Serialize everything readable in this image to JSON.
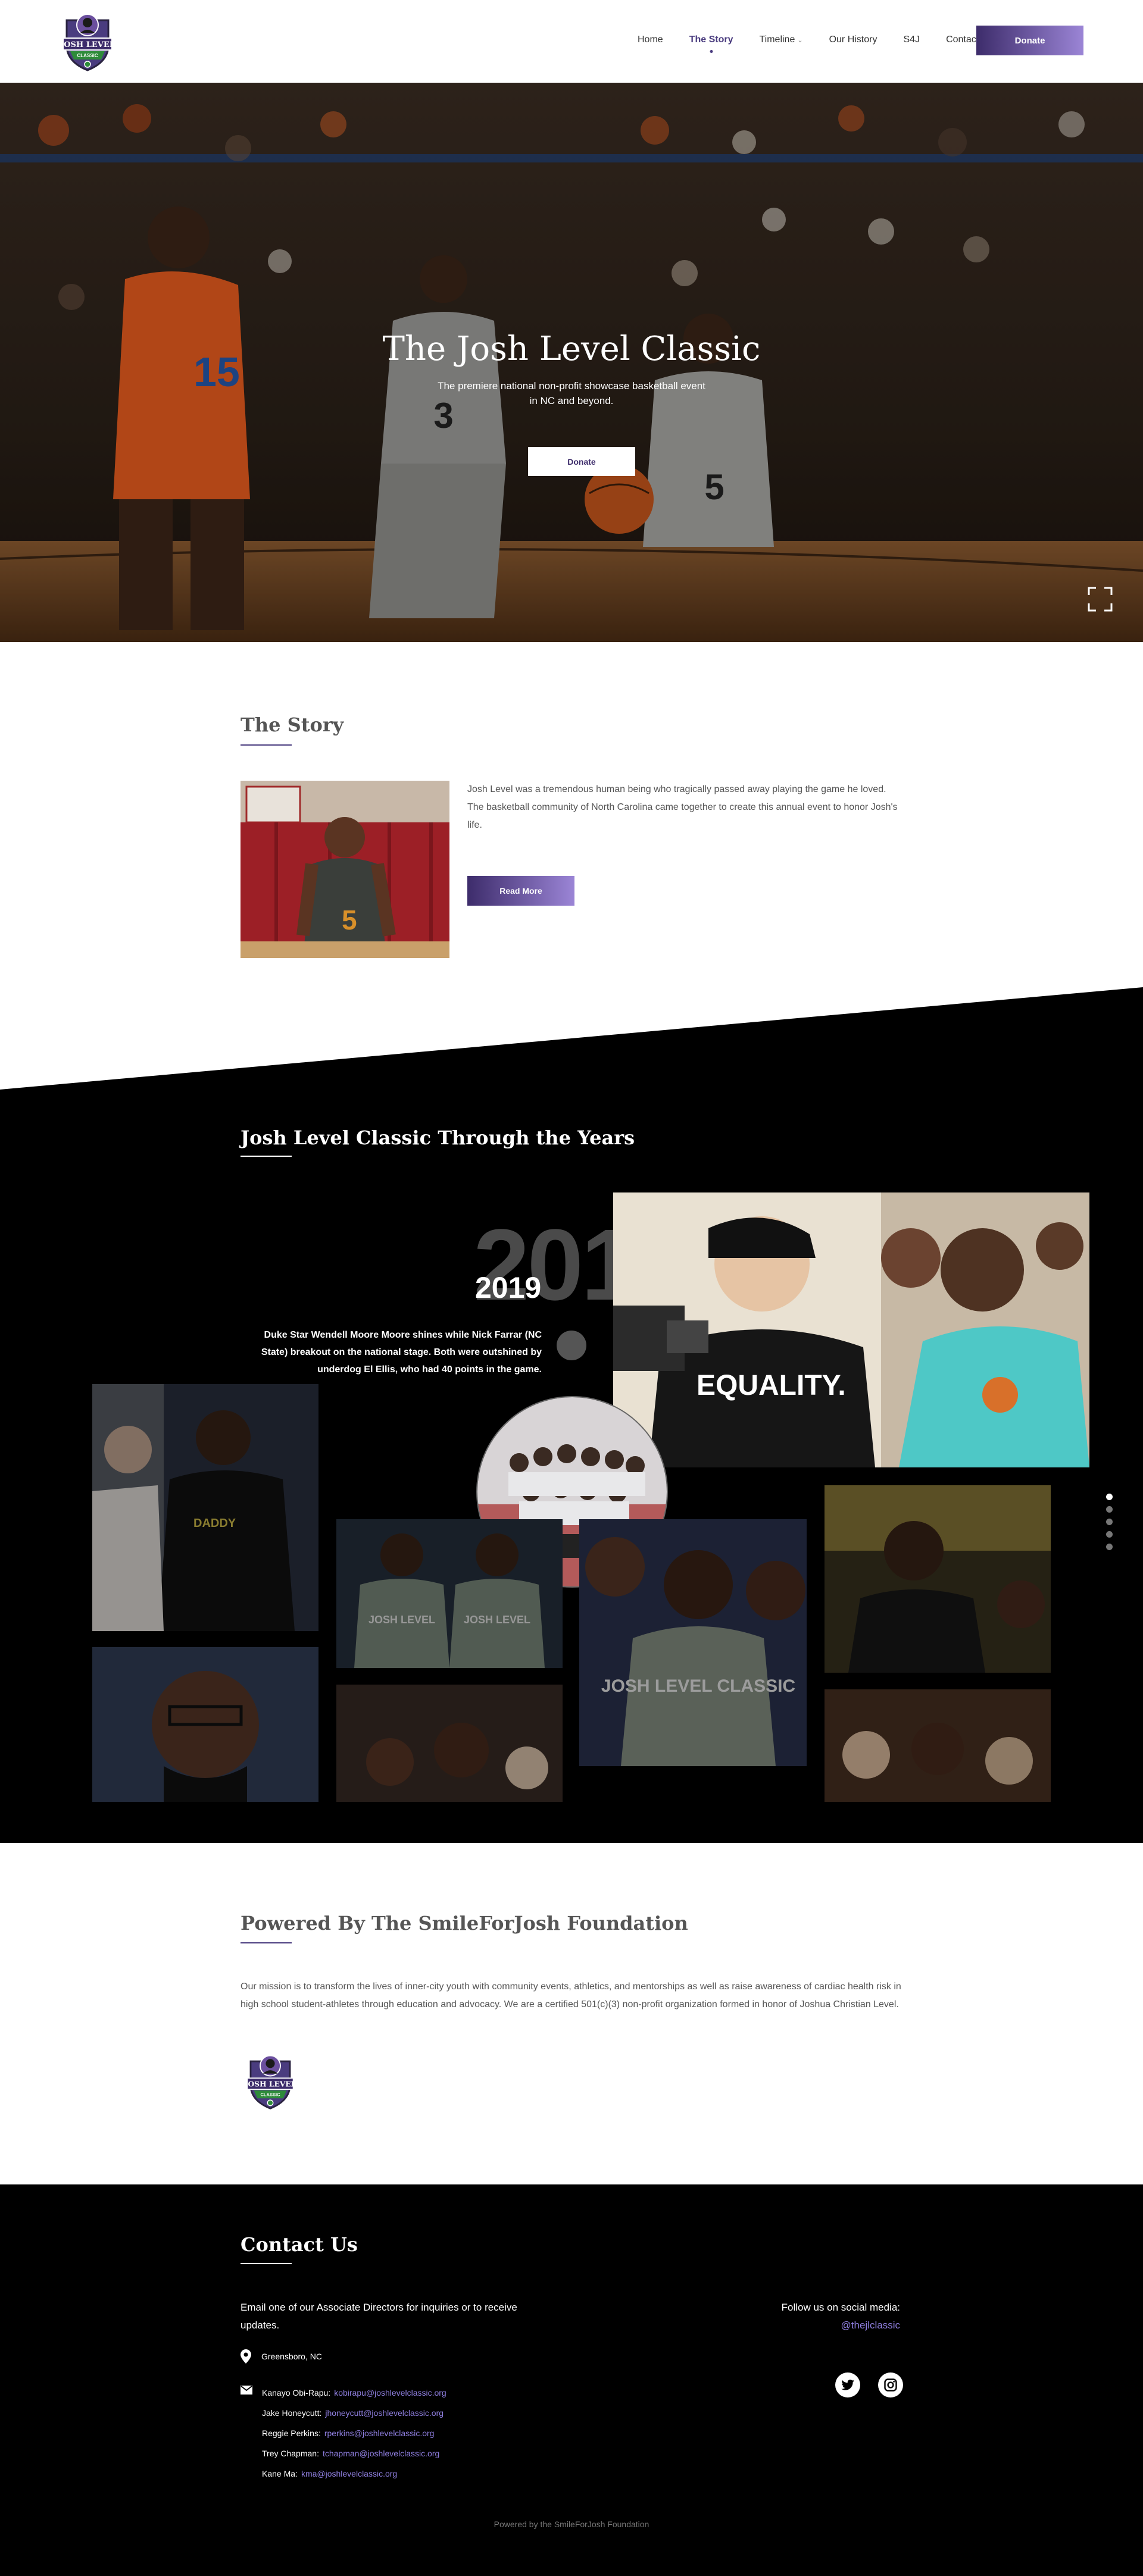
{
  "header": {
    "nav": [
      {
        "label": "Home"
      },
      {
        "label": "The Story"
      },
      {
        "label": "Timeline"
      },
      {
        "label": "Our History"
      },
      {
        "label": "S4J"
      },
      {
        "label": "Contact"
      }
    ],
    "donate_label": "Donate",
    "logo_text": "JOSH LEVEL CLASSIC"
  },
  "hero": {
    "title": "The Josh Level Classic",
    "subtitle": "The premiere national non-profit showcase basketball event in NC and beyond.",
    "donate_label": "Donate"
  },
  "story": {
    "title": "The Story",
    "text": "Josh Level was a tremendous human being who tragically passed away playing the game he loved.  The basketball community of North Carolina came together to create this annual event to honor Josh's life.",
    "read_more": "Read More"
  },
  "years": {
    "title": "Josh Level Classic Through the Years",
    "big_year": "2019",
    "year": "2019",
    "description": "Duke Star Wendell Moore Moore shines while Nick Farrar (NC State) breakout on the national stage. Both were outshined by underdog El Ellis, who had 40 points in the game.",
    "photo_texts": {
      "equality": "EQUALITY.",
      "jersey": "JOSH LEVEL CLASSIC"
    }
  },
  "foundation": {
    "title": "Powered By The SmileForJosh Foundation",
    "mission": "Our mission is to transform the lives of inner-city youth with community events, athletics, and mentorships as well as raise awareness of cardiac health risk in high school student-athletes through education and advocacy. We are a certified 501(c)(3) non-profit organization formed in honor of Joshua Christian Level."
  },
  "contact": {
    "title": "Contact Us",
    "intro": "Email one of our Associate Directors for inquiries or to receive updates.",
    "location": "Greensboro, NC",
    "directors": [
      {
        "name": "Kanayo Obi-Rapu:",
        "email": "kobirapu@joshlevelclassic.org"
      },
      {
        "name": "Jake Honeycutt:",
        "email": "jhoneycutt@joshlevelclassic.org"
      },
      {
        "name": "Reggie Perkins:",
        "email": "rperkins@joshlevelclassic.org"
      },
      {
        "name": "Trey Chapman:",
        "email": "tchapman@joshlevelclassic.org"
      },
      {
        "name": "Kane Ma:",
        "email": "kma@joshlevelclassic.org"
      }
    ],
    "follow": "Follow us on social media:",
    "handle": "@thejlclassic"
  },
  "footer": {
    "powered": "Powered by the SmileForJosh Foundation"
  },
  "colors": {
    "accent": "#4a3c7f",
    "accent_light": "#9b85d6",
    "link": "#8f7fe0"
  }
}
